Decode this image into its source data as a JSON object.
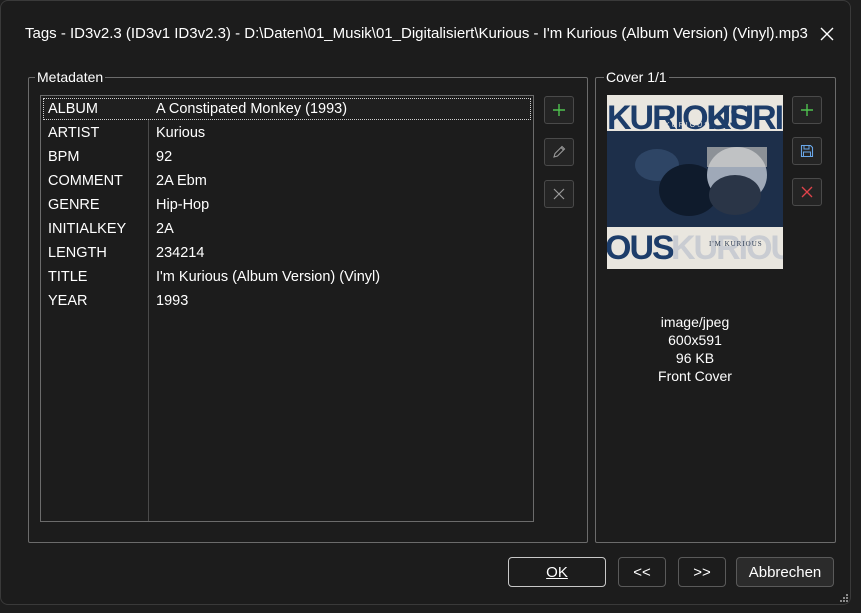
{
  "window": {
    "title": "Tags - ID3v2.3 (ID3v1 ID3v2.3) - D:\\Daten\\01_Musik\\01_Digitalisiert\\Kurious - I'm Kurious (Album Version) (Vinyl).mp3"
  },
  "metadata_group": {
    "label": "Metadaten",
    "rows": [
      {
        "key": "ALBUM",
        "value": "A Constipated Monkey (1993)"
      },
      {
        "key": "ARTIST",
        "value": "Kurious"
      },
      {
        "key": "BPM",
        "value": "92"
      },
      {
        "key": "COMMENT",
        "value": "2A Ebm"
      },
      {
        "key": "GENRE",
        "value": "Hip-Hop"
      },
      {
        "key": "INITIALKEY",
        "value": "2A"
      },
      {
        "key": "LENGTH",
        "value": "234214"
      },
      {
        "key": "TITLE",
        "value": "I'm Kurious (Album Version) (Vinyl)"
      },
      {
        "key": "YEAR",
        "value": "1993"
      }
    ],
    "selected_row": 0,
    "actions": {
      "add": "plus-icon",
      "edit": "pencil-icon",
      "delete": "x-icon"
    }
  },
  "cover_group": {
    "label": "Cover 1/1",
    "art": {
      "top_text": "KURIOUS",
      "top_right_text": "KURI",
      "bottom_left_text": "OUS",
      "bottom_right_text": "KURIOUS",
      "small_top": "KURIOUS",
      "small_bottom": "I'M KURIOUS"
    },
    "info": {
      "mime": "image/jpeg",
      "dimensions": "600x591",
      "size": "96 KB",
      "type": "Front Cover"
    },
    "actions": {
      "add": "plus-icon",
      "save": "floppy-disk-icon",
      "delete": "x-icon"
    }
  },
  "footer": {
    "ok": "OK",
    "prev": "<<",
    "next": ">>",
    "cancel": "Abbrechen"
  },
  "colors": {
    "background": "#1c1c1c",
    "border": "#6b6b6b",
    "add_green": "#4fc24f",
    "delete_red": "#e0424a",
    "save_blue": "#6aa7e8"
  }
}
